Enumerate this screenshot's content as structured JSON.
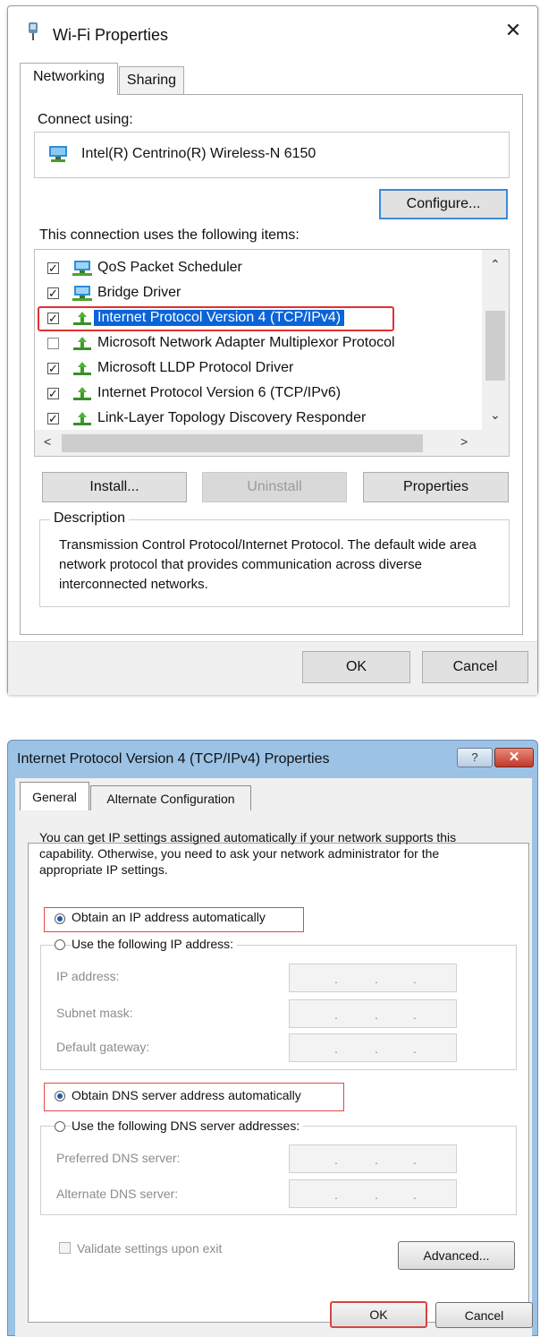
{
  "wifi_dialog": {
    "title": "Wi-Fi Properties",
    "close_glyph": "✕",
    "tabs": [
      "Networking",
      "Sharing"
    ],
    "connect_using_label": "Connect using:",
    "adapter_name": "Intel(R) Centrino(R) Wireless-N 6150",
    "configure_label": "Configure...",
    "items_label": "This connection uses the following items:",
    "items": [
      {
        "label": "QoS Packet Scheduler",
        "checked": true,
        "icon": "network-service-icon"
      },
      {
        "label": "Bridge Driver",
        "checked": true,
        "icon": "network-service-icon"
      },
      {
        "label": "Internet Protocol Version 4 (TCP/IPv4)",
        "checked": true,
        "icon": "protocol-icon",
        "selected": true
      },
      {
        "label": "Microsoft Network Adapter Multiplexor Protocol",
        "checked": false,
        "icon": "protocol-icon"
      },
      {
        "label": "Microsoft LLDP Protocol Driver",
        "checked": true,
        "icon": "protocol-icon"
      },
      {
        "label": "Internet Protocol Version 6 (TCP/IPv6)",
        "checked": true,
        "icon": "protocol-icon"
      },
      {
        "label": "Link-Layer Topology Discovery Responder",
        "checked": true,
        "icon": "protocol-icon"
      }
    ],
    "install_label": "Install...",
    "uninstall_label": "Uninstall",
    "properties_label": "Properties",
    "description_title": "Description",
    "description_text": "Transmission Control Protocol/Internet Protocol. The default wide area network protocol that provides communication across diverse interconnected networks.",
    "ok_label": "OK",
    "cancel_label": "Cancel",
    "highlight_color": "#e23030",
    "selection_color": "#0a64d8"
  },
  "ipv4_dialog": {
    "title": "Internet Protocol Version 4 (TCP/IPv4) Properties",
    "help_glyph": "?",
    "close_glyph": "✕",
    "tabs": [
      "General",
      "Alternate Configuration"
    ],
    "intro": "You can get IP settings assigned automatically if your network supports this capability. Otherwise, you need to ask your network administrator for the appropriate IP settings.",
    "ip_auto_label": "Obtain an IP address automatically",
    "ip_manual_label": "Use the following IP address:",
    "ip_fields": [
      "IP address:",
      "Subnet mask:",
      "Default gateway:"
    ],
    "dns_auto_label": "Obtain DNS server address automatically",
    "dns_manual_label": "Use the following DNS server addresses:",
    "dns_fields": [
      "Preferred DNS server:",
      "Alternate DNS server:"
    ],
    "ip_dot": ".",
    "validate_label": "Validate settings upon exit",
    "advanced_label": "Advanced...",
    "ok_label": "OK",
    "cancel_label": "Cancel",
    "ip_auto_selected": true,
    "dns_auto_selected": true,
    "titlebar_color": "#9cc3e6",
    "highlight_color": "#e04a4a"
  }
}
